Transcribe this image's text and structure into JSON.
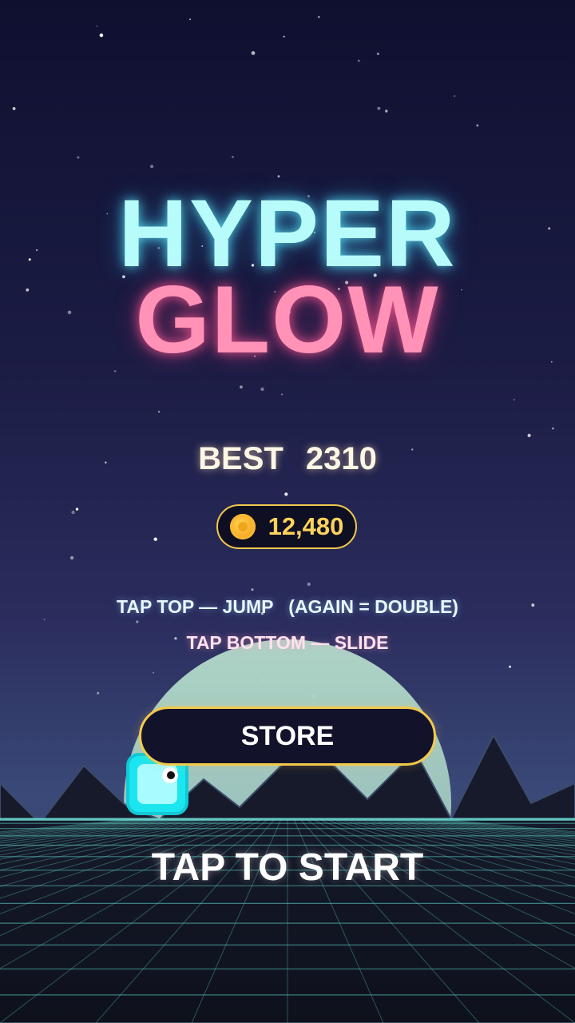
{
  "title": {
    "line1": "HYPER",
    "line2": "GLOW"
  },
  "best": {
    "label": "BEST",
    "value": "2310"
  },
  "coins": {
    "count": "12,480",
    "icon": "coin-icon"
  },
  "instructions": {
    "line1": "TAP TOP — JUMP   (AGAIN = DOUBLE)",
    "line2": "TAP BOTTOM — SLIDE"
  },
  "store_button": {
    "label": "STORE"
  },
  "start_prompt": "TAP TO START",
  "colors": {
    "title_cyan": "#b8fbfb",
    "title_pink": "#ff92b6",
    "gold_accent": "#f2c94c",
    "player_cyan": "#2ef2f8",
    "grid_teal": "#5fd3c8",
    "moon": "#a9d4c6"
  }
}
